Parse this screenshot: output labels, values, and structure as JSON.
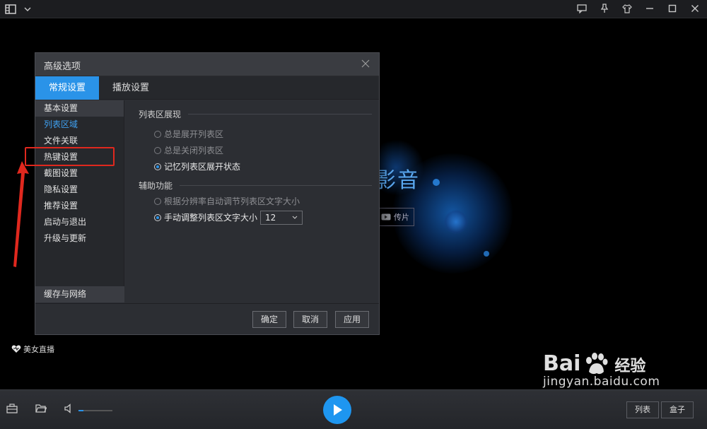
{
  "dialog": {
    "title": "高级选项",
    "tabs": [
      {
        "label": "常规设置",
        "active": true
      },
      {
        "label": "播放设置",
        "active": false
      }
    ],
    "sidebar": {
      "items": [
        {
          "label": "基本设置",
          "state": "selected"
        },
        {
          "label": "列表区域",
          "state": "active"
        },
        {
          "label": "文件关联",
          "state": ""
        },
        {
          "label": "热键设置",
          "state": ""
        },
        {
          "label": "截图设置",
          "state": ""
        },
        {
          "label": "隐私设置",
          "state": ""
        },
        {
          "label": "推荐设置",
          "state": ""
        },
        {
          "label": "启动与退出",
          "state": ""
        },
        {
          "label": "升级与更新",
          "state": ""
        }
      ],
      "bottom_item": "缓存与网络"
    },
    "sections": {
      "list_display": {
        "title": "列表区展现",
        "options": [
          {
            "label": "总是展开列表区",
            "checked": false
          },
          {
            "label": "总是关闭列表区",
            "checked": false
          },
          {
            "label": "记忆列表区展开状态",
            "checked": true
          }
        ]
      },
      "aux": {
        "title": "辅助功能",
        "options": [
          {
            "label": "根据分辨率自动调节列表区文字大小",
            "checked": false
          },
          {
            "label": "手动调整列表区文字大小",
            "checked": true
          }
        ],
        "font_size_value": "12"
      }
    },
    "buttons": {
      "ok": "确定",
      "cancel": "取消",
      "apply": "应用"
    }
  },
  "player": {
    "logo_text": "影音",
    "cast_label": "传片",
    "live_label": "美女直播",
    "volume_level": 0.15,
    "list_button": "列表",
    "box_button": "盒子"
  },
  "watermark": {
    "brand": "Bai",
    "brand_cn": "经验",
    "url": "jingyan.baidu.com"
  },
  "colors": {
    "accent": "#2a93e8",
    "annotation": "#e0281e"
  }
}
